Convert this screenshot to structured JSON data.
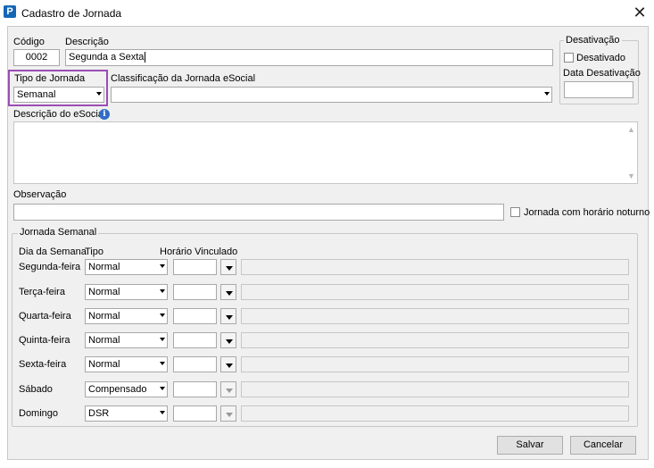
{
  "window": {
    "title": "Cadastro de Jornada",
    "icon": "app-p-icon",
    "close": "✕"
  },
  "codigo": {
    "label": "Código",
    "value": "0002"
  },
  "descricao": {
    "label": "Descrição",
    "value": "Segunda a Sexta"
  },
  "desativacao": {
    "group_title": "Desativação",
    "checkbox_label": "Desativado",
    "data_label": "Data Desativação",
    "data_value": ""
  },
  "tipo_jornada": {
    "label": "Tipo de Jornada",
    "value": "Semanal"
  },
  "classificacao": {
    "label": "Classificação da Jornada eSocial",
    "value": ""
  },
  "descricao_esocial": {
    "label": "Descrição do eSocial",
    "info_icon": "i"
  },
  "observacao": {
    "label": "Observação",
    "value": "",
    "noturno_label": "Jornada com horário noturno"
  },
  "jornada_semanal": {
    "group_title": "Jornada Semanal",
    "headers": {
      "dia": "Dia da Semana",
      "tipo": "Tipo",
      "horario": "Horário Vinculado"
    },
    "rows": [
      {
        "dia": "Segunda-feira",
        "tipo": "Normal",
        "horario_enabled": true
      },
      {
        "dia": "Terça-feira",
        "tipo": "Normal",
        "horario_enabled": true
      },
      {
        "dia": "Quarta-feira",
        "tipo": "Normal",
        "horario_enabled": true
      },
      {
        "dia": "Quinta-feira",
        "tipo": "Normal",
        "horario_enabled": true
      },
      {
        "dia": "Sexta-feira",
        "tipo": "Normal",
        "horario_enabled": true
      },
      {
        "dia": "Sábado",
        "tipo": "Compensado",
        "horario_enabled": false
      },
      {
        "dia": "Domingo",
        "tipo": "DSR",
        "horario_enabled": false
      }
    ]
  },
  "buttons": {
    "save": "Salvar",
    "cancel": "Cancelar"
  },
  "colors": {
    "highlight": "#9b4db5",
    "app_icon": "#1565b7",
    "dialog_bg": "#f0f0f0"
  }
}
